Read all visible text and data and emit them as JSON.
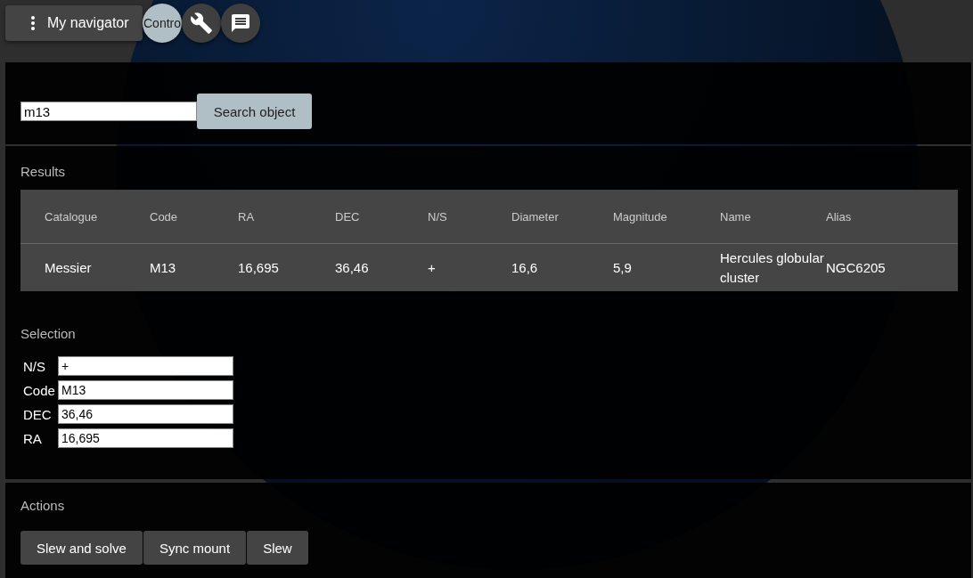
{
  "menu_button": {
    "label": "My navigator"
  },
  "tabs": [
    {
      "kind": "text",
      "label": "Contro",
      "selected": true
    },
    {
      "kind": "wrench",
      "selected": false
    },
    {
      "kind": "chat",
      "selected": false
    }
  ],
  "search": {
    "value": "m13",
    "button": "Search object"
  },
  "results": {
    "title": "Results",
    "columns": [
      "Catalogue",
      "Code",
      "RA",
      "DEC",
      "N/S",
      "Diameter",
      "Magnitude",
      "Name",
      "Alias"
    ],
    "rows": [
      [
        "Messier",
        "M13",
        "16,695",
        "36,46",
        "+",
        "16,6",
        "5,9",
        "Hercules globular cluster",
        "NGC6205"
      ]
    ]
  },
  "selection": {
    "title": "Selection",
    "fields": [
      {
        "label": "N/S",
        "value": "+"
      },
      {
        "label": "Code",
        "value": "M13"
      },
      {
        "label": "DEC",
        "value": "36,46"
      },
      {
        "label": "RA",
        "value": "16,695"
      }
    ]
  },
  "actions": {
    "title": "Actions",
    "buttons": [
      "Slew and solve",
      "Sync mount",
      "Slew"
    ]
  }
}
